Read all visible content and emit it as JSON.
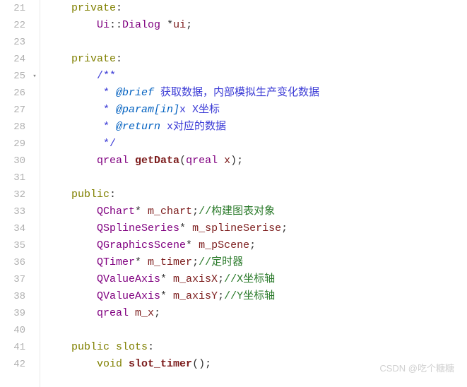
{
  "gutter": {
    "start": 21,
    "end": 42,
    "fold_marker_line": 25
  },
  "code": {
    "lines": [
      {
        "n": 21,
        "tokens": [
          {
            "t": "    ",
            "c": ""
          },
          {
            "t": "private",
            "c": "kw"
          },
          {
            "t": ":",
            "c": "punct"
          }
        ]
      },
      {
        "n": 22,
        "tokens": [
          {
            "t": "        ",
            "c": ""
          },
          {
            "t": "Ui",
            "c": "type"
          },
          {
            "t": "::",
            "c": "punct"
          },
          {
            "t": "Dialog",
            "c": "type"
          },
          {
            "t": " *",
            "c": "punct"
          },
          {
            "t": "ui",
            "c": "ident"
          },
          {
            "t": ";",
            "c": "punct"
          }
        ]
      },
      {
        "n": 23,
        "tokens": []
      },
      {
        "n": 24,
        "tokens": [
          {
            "t": "    ",
            "c": ""
          },
          {
            "t": "private",
            "c": "kw"
          },
          {
            "t": ":",
            "c": "punct"
          }
        ]
      },
      {
        "n": 25,
        "tokens": [
          {
            "t": "        ",
            "c": ""
          },
          {
            "t": "/**",
            "c": "doc"
          }
        ]
      },
      {
        "n": 26,
        "tokens": [
          {
            "t": "         ",
            "c": ""
          },
          {
            "t": "* ",
            "c": "doc"
          },
          {
            "t": "@brief",
            "c": "doctag"
          },
          {
            "t": " 获取数据，内部模拟生产变化数据",
            "c": "doc"
          }
        ]
      },
      {
        "n": 27,
        "tokens": [
          {
            "t": "         ",
            "c": ""
          },
          {
            "t": "* ",
            "c": "doc"
          },
          {
            "t": "@param[in]",
            "c": "doctag"
          },
          {
            "t": "x X坐标",
            "c": "doc"
          }
        ]
      },
      {
        "n": 28,
        "tokens": [
          {
            "t": "         ",
            "c": ""
          },
          {
            "t": "* ",
            "c": "doc"
          },
          {
            "t": "@return",
            "c": "doctag"
          },
          {
            "t": " x对应的数据",
            "c": "doc"
          }
        ]
      },
      {
        "n": 29,
        "tokens": [
          {
            "t": "         ",
            "c": ""
          },
          {
            "t": "*/",
            "c": "doc"
          }
        ]
      },
      {
        "n": 30,
        "tokens": [
          {
            "t": "        ",
            "c": ""
          },
          {
            "t": "qreal",
            "c": "type"
          },
          {
            "t": " ",
            "c": ""
          },
          {
            "t": "getData",
            "c": "func"
          },
          {
            "t": "(",
            "c": "punct"
          },
          {
            "t": "qreal",
            "c": "type"
          },
          {
            "t": " ",
            "c": ""
          },
          {
            "t": "x",
            "c": "ident"
          },
          {
            "t": ");",
            "c": "punct"
          }
        ]
      },
      {
        "n": 31,
        "tokens": []
      },
      {
        "n": 32,
        "tokens": [
          {
            "t": "    ",
            "c": ""
          },
          {
            "t": "public",
            "c": "kw"
          },
          {
            "t": ":",
            "c": "punct"
          }
        ]
      },
      {
        "n": 33,
        "tokens": [
          {
            "t": "        ",
            "c": ""
          },
          {
            "t": "QChart",
            "c": "type"
          },
          {
            "t": "* ",
            "c": "punct"
          },
          {
            "t": "m_chart",
            "c": "ident"
          },
          {
            "t": ";",
            "c": "punct"
          },
          {
            "t": "//构建图表对象",
            "c": "comment"
          }
        ]
      },
      {
        "n": 34,
        "tokens": [
          {
            "t": "        ",
            "c": ""
          },
          {
            "t": "QSplineSeries",
            "c": "type"
          },
          {
            "t": "* ",
            "c": "punct"
          },
          {
            "t": "m_splineSerise",
            "c": "ident"
          },
          {
            "t": ";",
            "c": "punct"
          }
        ]
      },
      {
        "n": 35,
        "tokens": [
          {
            "t": "        ",
            "c": ""
          },
          {
            "t": "QGraphicsScene",
            "c": "type"
          },
          {
            "t": "* ",
            "c": "punct"
          },
          {
            "t": "m_pScene",
            "c": "ident"
          },
          {
            "t": ";",
            "c": "punct"
          }
        ]
      },
      {
        "n": 36,
        "tokens": [
          {
            "t": "        ",
            "c": ""
          },
          {
            "t": "QTimer",
            "c": "type"
          },
          {
            "t": "* ",
            "c": "punct"
          },
          {
            "t": "m_timer",
            "c": "ident"
          },
          {
            "t": ";",
            "c": "punct"
          },
          {
            "t": "//定时器",
            "c": "comment"
          }
        ]
      },
      {
        "n": 37,
        "tokens": [
          {
            "t": "        ",
            "c": ""
          },
          {
            "t": "QValueAxis",
            "c": "type"
          },
          {
            "t": "* ",
            "c": "punct"
          },
          {
            "t": "m_axisX",
            "c": "ident"
          },
          {
            "t": ";",
            "c": "punct"
          },
          {
            "t": "//X坐标轴",
            "c": "comment"
          }
        ]
      },
      {
        "n": 38,
        "tokens": [
          {
            "t": "        ",
            "c": ""
          },
          {
            "t": "QValueAxis",
            "c": "type"
          },
          {
            "t": "* ",
            "c": "punct"
          },
          {
            "t": "m_axisY",
            "c": "ident"
          },
          {
            "t": ";",
            "c": "punct"
          },
          {
            "t": "//Y坐标轴",
            "c": "comment"
          }
        ]
      },
      {
        "n": 39,
        "tokens": [
          {
            "t": "        ",
            "c": ""
          },
          {
            "t": "qreal",
            "c": "type"
          },
          {
            "t": " ",
            "c": ""
          },
          {
            "t": "m_x",
            "c": "ident"
          },
          {
            "t": ";",
            "c": "punct"
          }
        ]
      },
      {
        "n": 40,
        "tokens": []
      },
      {
        "n": 41,
        "tokens": [
          {
            "t": "    ",
            "c": ""
          },
          {
            "t": "public",
            "c": "kw"
          },
          {
            "t": " ",
            "c": ""
          },
          {
            "t": "slots",
            "c": "kw"
          },
          {
            "t": ":",
            "c": "punct"
          }
        ]
      },
      {
        "n": 42,
        "tokens": [
          {
            "t": "        ",
            "c": ""
          },
          {
            "t": "void",
            "c": "kw"
          },
          {
            "t": " ",
            "c": ""
          },
          {
            "t": "slot_timer",
            "c": "func"
          },
          {
            "t": "();",
            "c": "punct"
          }
        ]
      }
    ]
  },
  "watermark": "CSDN @吃个糖糖"
}
